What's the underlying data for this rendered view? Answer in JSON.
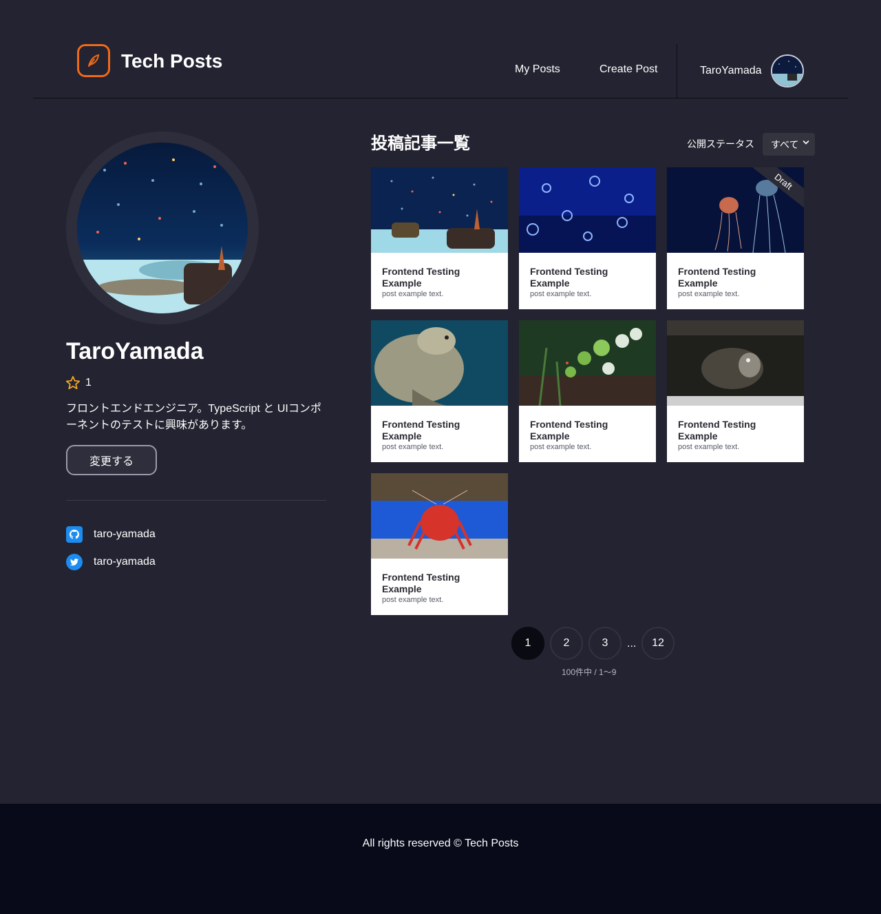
{
  "header": {
    "brand": "Tech Posts",
    "nav": {
      "my_posts": "My Posts",
      "create_post": "Create Post"
    },
    "user_name": "TaroYamada"
  },
  "profile": {
    "name": "TaroYamada",
    "star_count": "1",
    "bio": "フロントエンドエンジニア。TypeScript と UIコンポーネントのテストに興味があります。",
    "edit_label": "変更する",
    "github": "taro-yamada",
    "twitter": "taro-yamada"
  },
  "posts": {
    "title": "投稿記事一覧",
    "status_label": "公開ステータス",
    "status_value": "すべて",
    "draft_label": "Draft",
    "cards": [
      {
        "title": "Frontend Testing Example",
        "body": "post example text."
      },
      {
        "title": "Frontend Testing Example",
        "body": "post example text."
      },
      {
        "title": "Frontend Testing Example",
        "body": "post example text."
      },
      {
        "title": "Frontend Testing Example",
        "body": "post example text."
      },
      {
        "title": "Frontend Testing Example",
        "body": "post example text."
      },
      {
        "title": "Frontend Testing Example",
        "body": "post example text."
      },
      {
        "title": "Frontend Testing Example",
        "body": "post example text."
      }
    ]
  },
  "pagination": {
    "pages": [
      "1",
      "2",
      "3",
      "12"
    ],
    "ellipsis": "...",
    "info": "100件中 / 1〜9"
  },
  "footer": {
    "text": "All rights reserved © Tech Posts"
  },
  "colors": {
    "background": "#232331",
    "accent": "#f06a18",
    "footer": "#080a19",
    "social_blue": "#1d8cf0",
    "star": "#f5a623"
  },
  "icons": {
    "logo": "feather-icon",
    "star": "star-icon",
    "github": "github-icon",
    "twitter": "twitter-icon",
    "select": "chevron-down-icon"
  }
}
